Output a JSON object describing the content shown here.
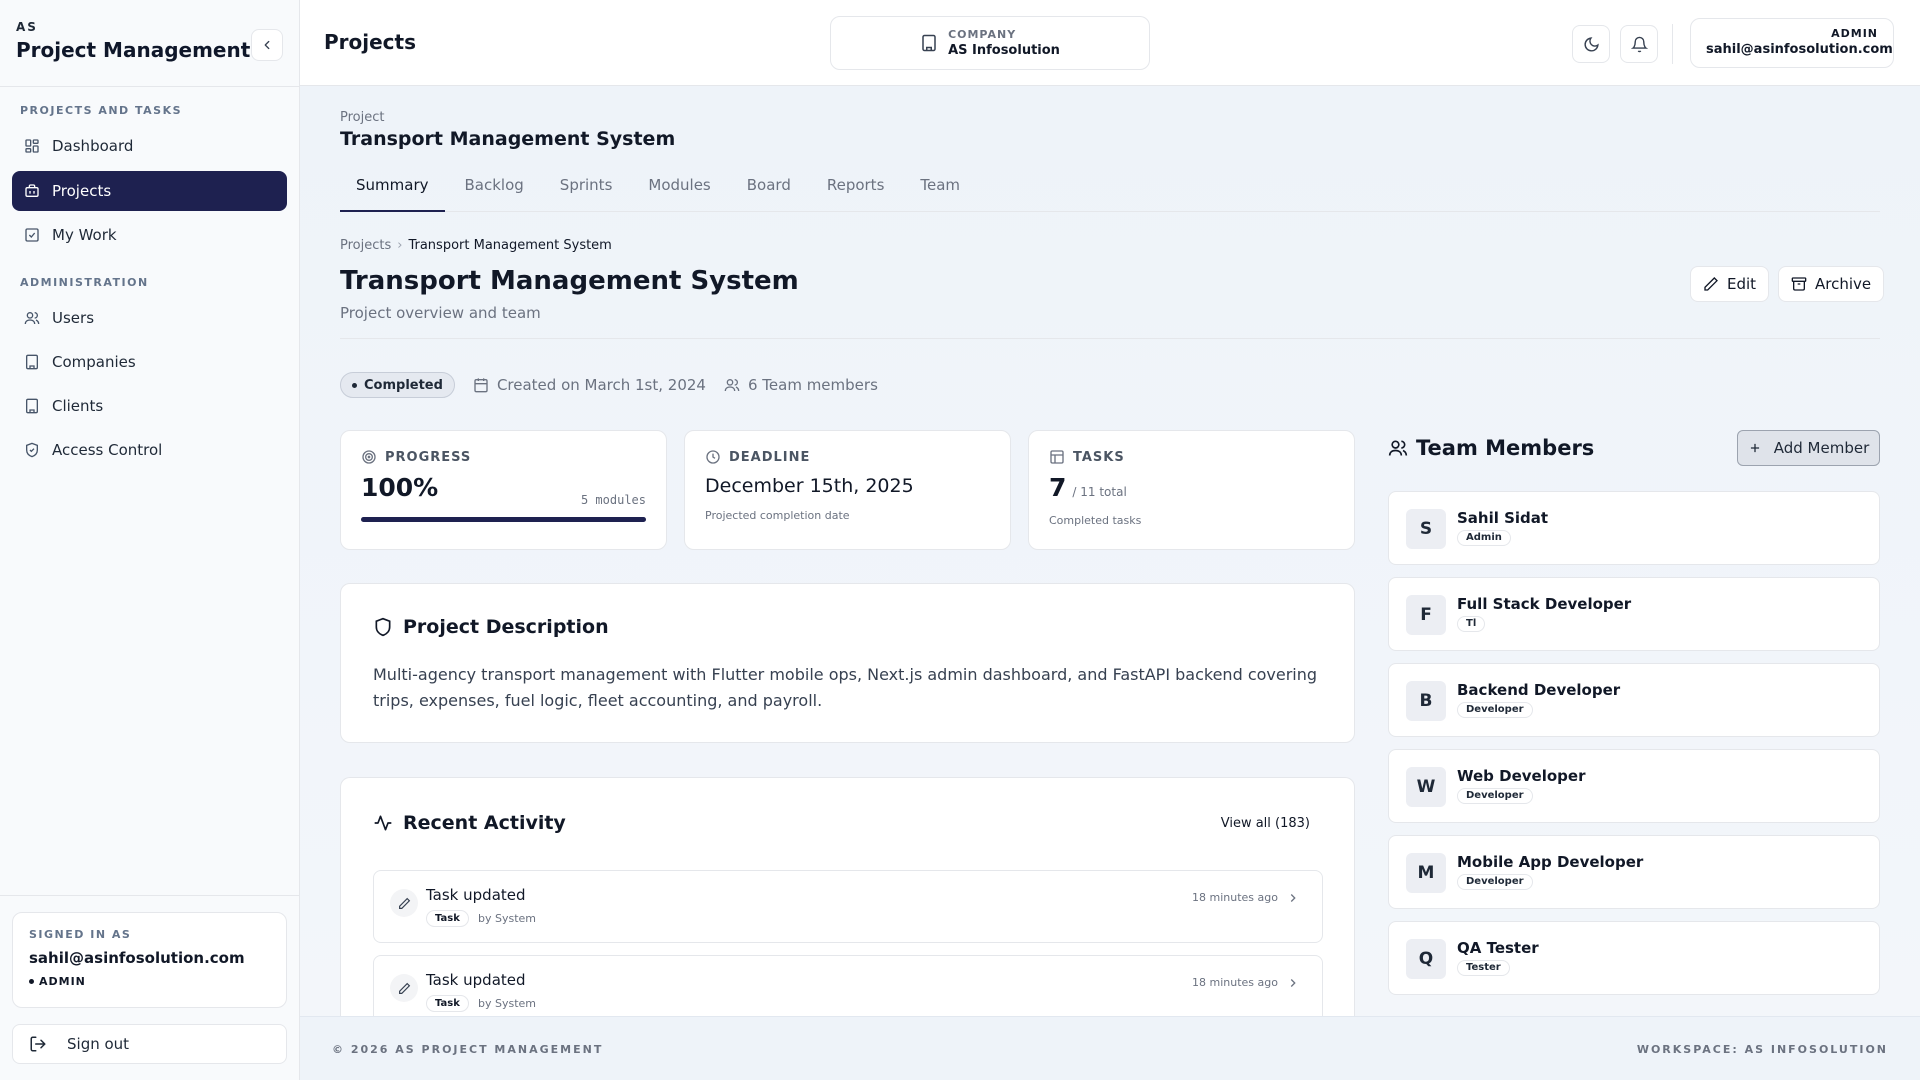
{
  "sidebar": {
    "brand_sub": "AS",
    "brand_title": "Project Management",
    "section_projects": "PROJECTS AND TASKS",
    "section_admin": "ADMINISTRATION",
    "items": [
      {
        "label": "Dashboard",
        "icon": "dashboard-icon"
      },
      {
        "label": "Projects",
        "icon": "briefcase-icon"
      },
      {
        "label": "My Work",
        "icon": "checkbox-icon"
      },
      {
        "label": "Users",
        "icon": "users-icon"
      },
      {
        "label": "Companies",
        "icon": "building-icon"
      },
      {
        "label": "Clients",
        "icon": "building-icon"
      },
      {
        "label": "Access Control",
        "icon": "shield-check-icon"
      }
    ],
    "signed_label": "SIGNED IN AS",
    "signed_email": "sahil@asinfosolution.com",
    "signed_role": "ADMIN",
    "signout": "Sign out"
  },
  "header": {
    "title": "Projects",
    "company_label": "COMPANY",
    "company_name": "AS Infosolution",
    "user_role": "ADMIN",
    "user_email": "sahil@asinfosolution.com"
  },
  "project": {
    "label": "Project",
    "name": "Transport Management System",
    "tabs": [
      "Summary",
      "Backlog",
      "Sprints",
      "Modules",
      "Board",
      "Reports",
      "Team"
    ],
    "breadcrumb": [
      "Projects",
      "Transport Management System"
    ],
    "title": "Transport Management System",
    "subtitle": "Project overview and team",
    "edit": "Edit",
    "archive": "Archive",
    "status": "Completed",
    "created": "Created on March 1st, 2024",
    "team_count": "6 Team members"
  },
  "stats": {
    "progress_label": "PROGRESS",
    "progress_value": "100%",
    "progress_fraction": 1.0,
    "progress_modules": "5 modules",
    "deadline_label": "DEADLINE",
    "deadline_value": "December 15th, 2025",
    "deadline_note": "Projected completion date",
    "tasks_label": "TASKS",
    "tasks_done": "7",
    "tasks_total": "/ 11 total",
    "tasks_note": "Completed tasks"
  },
  "description": {
    "title": "Project Description",
    "text": "Multi-agency transport management with Flutter mobile ops, Next.js admin dashboard, and FastAPI backend covering trips, expenses, fuel logic, fleet accounting, and payroll."
  },
  "activity": {
    "title": "Recent Activity",
    "view_all": "View all (183)",
    "items": [
      {
        "title": "Task updated",
        "badge": "Task",
        "by": "by System",
        "time": "18 minutes ago"
      },
      {
        "title": "Task updated",
        "badge": "Task",
        "by": "by System",
        "time": "18 minutes ago"
      }
    ]
  },
  "team": {
    "title": "Team Members",
    "add": "Add Member",
    "members": [
      {
        "initial": "S",
        "name": "Sahil Sidat",
        "role": "Admin"
      },
      {
        "initial": "F",
        "name": "Full Stack Developer",
        "role": "Tl"
      },
      {
        "initial": "B",
        "name": "Backend Developer",
        "role": "Developer"
      },
      {
        "initial": "W",
        "name": "Web Developer",
        "role": "Developer"
      },
      {
        "initial": "M",
        "name": "Mobile App Developer",
        "role": "Developer"
      },
      {
        "initial": "Q",
        "name": "QA Tester",
        "role": "Tester"
      }
    ]
  },
  "footer": {
    "left": "© 2026 AS PROJECT MANAGEMENT",
    "right": "WORKSPACE: AS INFOSOLUTION"
  },
  "colors": {
    "accent": "#1e2150",
    "sidebar_bg": "#f8fafc",
    "main_bg": "#f3f6fa"
  }
}
